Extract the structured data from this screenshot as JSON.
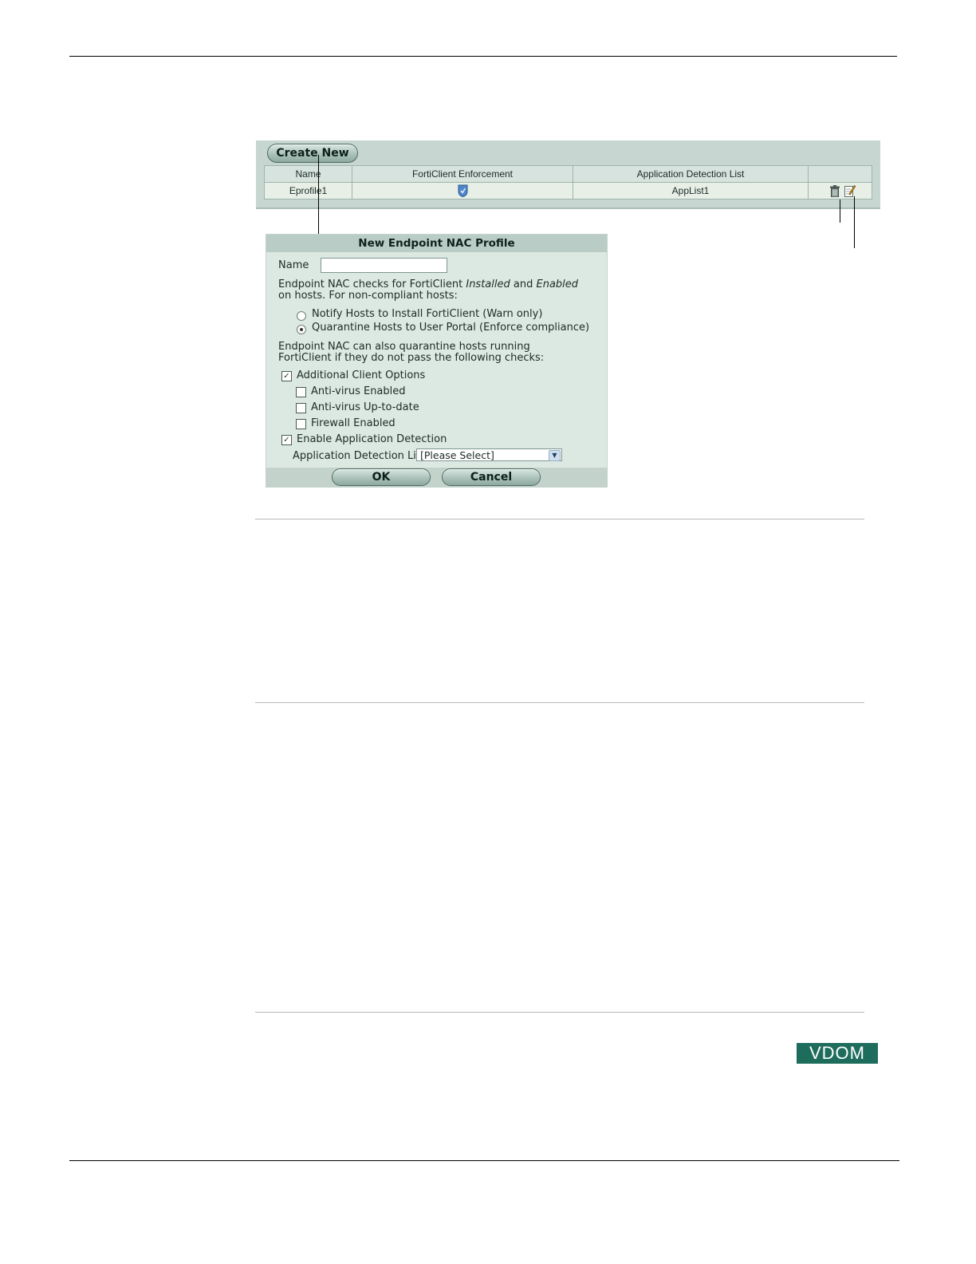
{
  "list": {
    "create_new_label": "Create New",
    "columns": [
      "Name",
      "FortiClient Enforcement",
      "Application Detection List",
      ""
    ],
    "rows": [
      {
        "name": "Eprofile1",
        "enforcement_icon": "shield-check-icon",
        "app_list": "AppList1"
      }
    ],
    "row_icons": [
      "trash-icon",
      "edit-icon"
    ]
  },
  "dialog": {
    "title": "New Endpoint NAC Profile",
    "name_label": "Name",
    "name_value": "",
    "intro_prefix": "Endpoint NAC checks for FortiClient ",
    "intro_installed": "Installed",
    "intro_and": " and ",
    "intro_enabled": "Enabled",
    "intro_suffix": " on hosts. For non-compliant hosts:",
    "radio_options": [
      {
        "label": "Notify Hosts to Install FortiClient (Warn only)",
        "selected": false
      },
      {
        "label": "Quarantine Hosts to User Portal (Enforce compliance)",
        "selected": true
      }
    ],
    "quarantine_text": "Endpoint NAC can also quarantine hosts running FortiClient if they do not pass the following checks:",
    "additional_client_options": {
      "label": "Additional Client Options",
      "checked": true
    },
    "sub_options": [
      {
        "label": "Anti-virus Enabled",
        "checked": false
      },
      {
        "label": "Anti-virus Up-to-date",
        "checked": false
      },
      {
        "label": "Firewall Enabled",
        "checked": false
      }
    ],
    "enable_app_detection": {
      "label": "Enable Application Detection",
      "checked": true
    },
    "app_detection_list_label": "Application Detection List",
    "app_detection_list_value": "[Please Select]",
    "ok_label": "OK",
    "cancel_label": "Cancel"
  },
  "badge": {
    "vdom_label": "VDOM"
  },
  "colors": {
    "panel_bg": "#c7d6d0",
    "dialog_bg": "#dce8e2",
    "badge_bg": "#1e6d5c"
  }
}
